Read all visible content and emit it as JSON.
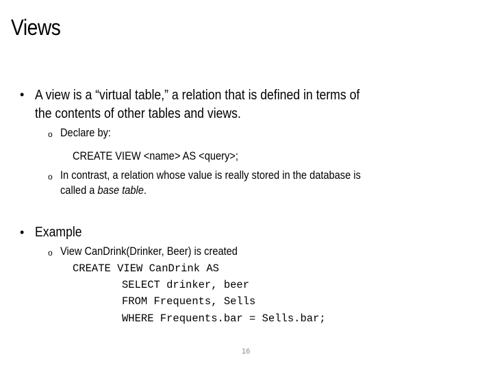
{
  "title": "Views",
  "bullets": [
    {
      "line1": "A view is a “virtual table,” a relation that is defined in terms of",
      "line2": "the contents of other tables and views.",
      "sub": [
        {
          "text": "Declare by:",
          "code": "CREATE VIEW <name> AS <query>;"
        },
        {
          "line1": "In contrast, a relation whose value is really stored in the database is",
          "line2_prefix": "called a ",
          "line2_italic": "base table",
          "line2_suffix": "."
        }
      ]
    },
    {
      "label": "Example",
      "sub": [
        {
          "text": "View CanDrink(Drinker, Beer) is created"
        }
      ],
      "code": [
        "CREATE VIEW CanDrink AS",
        "SELECT drinker, beer",
        "FROM Frequents, Sells",
        "WHERE Frequents.bar = Sells.bar;"
      ]
    }
  ],
  "bullet_glyph": "•",
  "sub_bullet_glyph": "o",
  "page_number": "16"
}
